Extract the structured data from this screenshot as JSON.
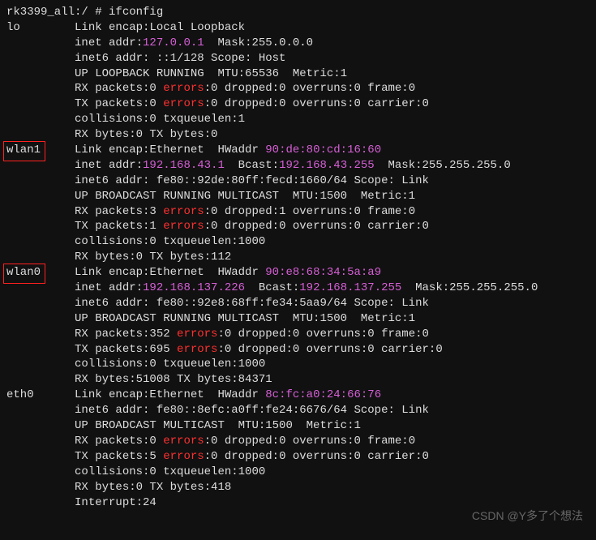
{
  "prompt": "rk3399_all:/ # ifconfig",
  "watermark": "CSDN @Y多了个想法",
  "ifaces": [
    {
      "name": "lo",
      "boxed": false,
      "link_encap": "Local Loopback",
      "hwaddr": null,
      "inet_addr": "127.0.0.1",
      "mask_fmt": "Mask:",
      "mask": "255.0.0.0",
      "bcast": null,
      "bcast_mask": null,
      "inet6": "::1/128",
      "inet6_scope": "Host",
      "flags": "UP LOOPBACK RUNNING",
      "mtu": "65536",
      "metric": "1",
      "rx_packets": "0",
      "rx_errors": "0",
      "rx_dropped": "0",
      "rx_overruns": "0",
      "rx_frame": "0",
      "tx_packets": "0",
      "tx_errors": "0",
      "tx_dropped": "0",
      "tx_overruns": "0",
      "tx_carrier": "0",
      "collisions": "0",
      "txqueuelen": "1",
      "rx_bytes": "0",
      "tx_bytes": "0",
      "interrupt": null
    },
    {
      "name": "wlan1",
      "boxed": true,
      "link_encap": "Ethernet",
      "hwaddr": "90:de:80:cd:16:60",
      "inet_addr": "192.168.43.1",
      "mask_fmt": "Mask:",
      "mask": null,
      "bcast": "192.168.43.255",
      "bcast_mask": "255.255.255.0",
      "inet6": "fe80::92de:80ff:fecd:1660/64",
      "inet6_scope": "Link",
      "flags": "UP BROADCAST RUNNING MULTICAST",
      "mtu": "1500",
      "metric": "1",
      "rx_packets": "3",
      "rx_errors": "0",
      "rx_dropped": "1",
      "rx_overruns": "0",
      "rx_frame": "0",
      "tx_packets": "1",
      "tx_errors": "0",
      "tx_dropped": "0",
      "tx_overruns": "0",
      "tx_carrier": "0",
      "collisions": "0",
      "txqueuelen": "1000",
      "rx_bytes": "0",
      "tx_bytes": "112",
      "interrupt": null
    },
    {
      "name": "wlan0",
      "boxed": true,
      "link_encap": "Ethernet",
      "hwaddr": "90:e8:68:34:5a:a9",
      "inet_addr": "192.168.137.226",
      "mask_fmt": "Mask:",
      "mask": null,
      "bcast": "192.168.137.255",
      "bcast_mask": "255.255.255.0",
      "inet6": "fe80::92e8:68ff:fe34:5aa9/64",
      "inet6_scope": "Link",
      "flags": "UP BROADCAST RUNNING MULTICAST",
      "mtu": "1500",
      "metric": "1",
      "rx_packets": "352",
      "rx_errors": "0",
      "rx_dropped": "0",
      "rx_overruns": "0",
      "rx_frame": "0",
      "tx_packets": "695",
      "tx_errors": "0",
      "tx_dropped": "0",
      "tx_overruns": "0",
      "tx_carrier": "0",
      "collisions": "0",
      "txqueuelen": "1000",
      "rx_bytes": "51008",
      "tx_bytes": "84371",
      "interrupt": null
    },
    {
      "name": "eth0",
      "boxed": false,
      "link_encap": "Ethernet",
      "hwaddr": "8c:fc:a0:24:66:76",
      "inet_addr": null,
      "mask_fmt": null,
      "mask": null,
      "bcast": null,
      "bcast_mask": null,
      "inet6": "fe80::8efc:a0ff:fe24:6676/64",
      "inet6_scope": "Link",
      "flags": "UP BROADCAST MULTICAST",
      "mtu": "1500",
      "metric": "1",
      "rx_packets": "0",
      "rx_errors": "0",
      "rx_dropped": "0",
      "rx_overruns": "0",
      "rx_frame": "0",
      "tx_packets": "5",
      "tx_errors": "0",
      "tx_dropped": "0",
      "tx_overruns": "0",
      "tx_carrier": "0",
      "collisions": "0",
      "txqueuelen": "1000",
      "rx_bytes": "0",
      "tx_bytes": "418",
      "interrupt": "24"
    }
  ]
}
